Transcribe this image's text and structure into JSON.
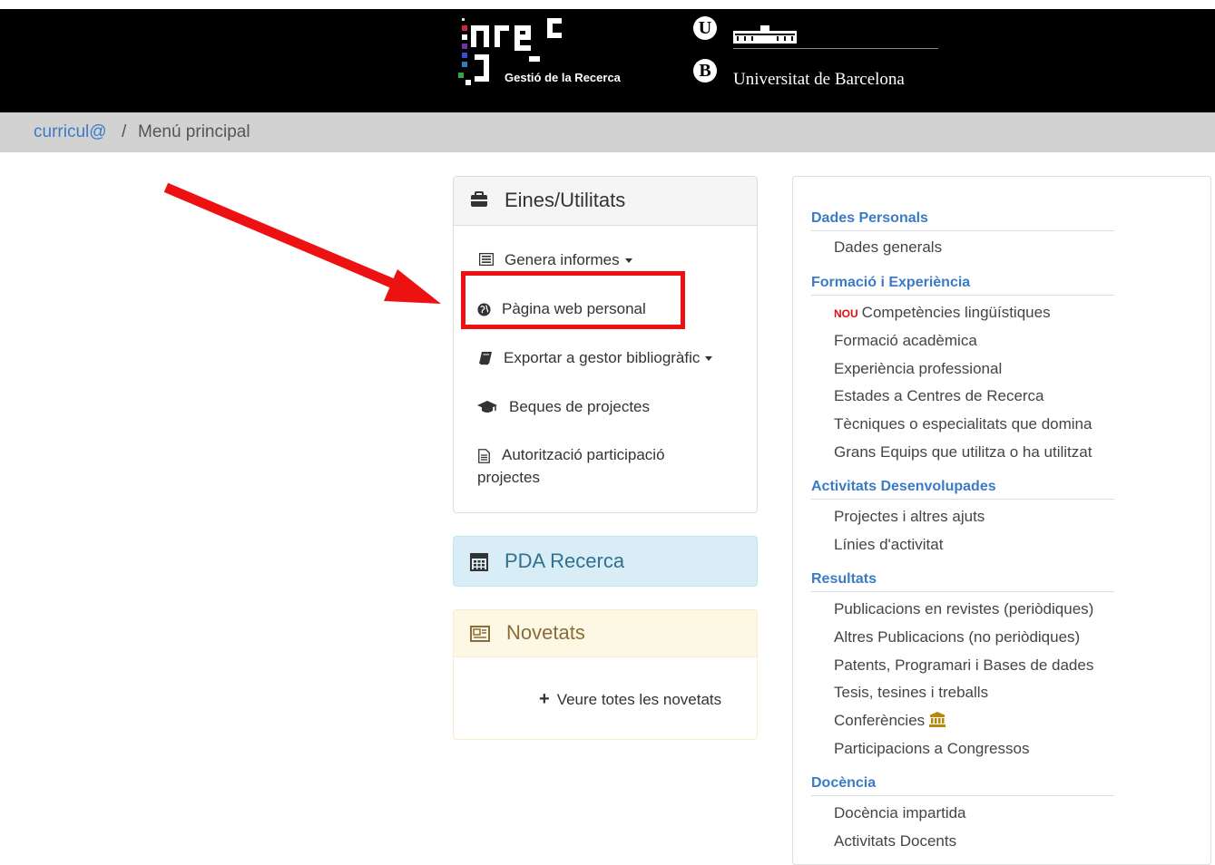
{
  "header": {
    "grec_subtitle": "Gestió de la Recerca",
    "ub_letter_top": "U",
    "ub_letter_bottom": "B",
    "ub_name": "Universitat de Barcelona"
  },
  "breadcrumb": {
    "home": "curricul@",
    "separator": "/",
    "current": "Menú principal"
  },
  "tools_panel": {
    "title": "Eines/Utilitats",
    "items": [
      {
        "label": "Genera informes",
        "icon": "list-icon",
        "dropdown": true
      },
      {
        "label": "Pàgina web personal",
        "icon": "globe-icon",
        "dropdown": false
      },
      {
        "label": "Exportar a gestor bibliogràfic",
        "icon": "book-icon",
        "dropdown": true
      },
      {
        "label": "Beques de projectes",
        "icon": "graduation-cap-icon",
        "dropdown": false
      },
      {
        "label": "Autorització participació",
        "label2": "projectes",
        "icon": "document-icon",
        "dropdown": false
      }
    ]
  },
  "pda_panel": {
    "title": "PDA Recerca",
    "icon": "calculator-icon"
  },
  "news_panel": {
    "title": "Novetats",
    "icon": "newspaper-icon",
    "link": "Veure totes les novetats"
  },
  "cv_menu": {
    "sections": [
      {
        "title": "Dades Personals",
        "items": [
          "Dades generals"
        ]
      },
      {
        "title": "Formació i Experiència",
        "items": [
          "Competències lingüístiques",
          "Formació acadèmica",
          "Experiència professional",
          "Estades a Centres de Recerca",
          "Tècniques o especialitats que domina",
          "Grans Equips que utilitza o ha utilitzat"
        ]
      },
      {
        "title": "Activitats Desenvolupades",
        "items": [
          "Projectes i altres ajuts",
          "Línies d'activitat"
        ]
      },
      {
        "title": "Resultats",
        "items": [
          "Publicacions en revistes (periòdiques)",
          "Altres Publicacions (no periòdiques)",
          "Patents, Programari i Bases de dades",
          "Tesis, tesines i treballs",
          "Conferències",
          "Participacions a Congressos"
        ]
      },
      {
        "title": "Docència",
        "items": [
          "Docència impartida",
          "Activitats Docents"
        ]
      }
    ],
    "new_badge": "NOU"
  },
  "colors": {
    "link_blue": "#3a7bc5",
    "annotation_red": "#ee1111",
    "header_black": "#000000"
  }
}
